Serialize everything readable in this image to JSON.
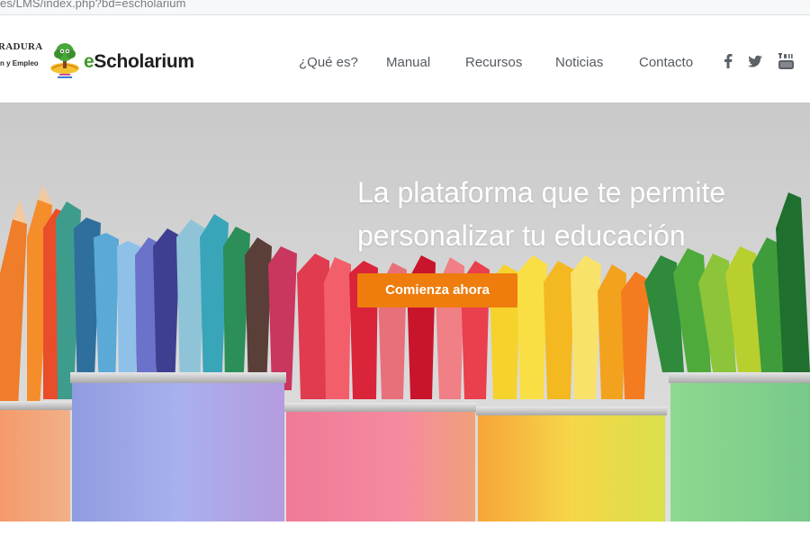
{
  "browser": {
    "url_text": "es/LMS/index.php?bd=escholarium"
  },
  "header": {
    "gov_logo_line1": "RADURA",
    "gov_logo_line2": "n y Empleo",
    "brand_name_prefix": "e",
    "brand_name_rest": "Scholarium",
    "brand_icon": "tree-book-icon"
  },
  "nav": {
    "items": [
      {
        "label": "¿Qué es?"
      },
      {
        "label": "Manual"
      },
      {
        "label": "Recursos"
      },
      {
        "label": "Noticias"
      },
      {
        "label": "Contacto"
      }
    ],
    "social": [
      {
        "icon": "facebook-icon"
      },
      {
        "icon": "twitter-icon"
      },
      {
        "icon": "youtube-icon"
      }
    ]
  },
  "hero": {
    "title": "La plataforma que te permite personalizar tu educación",
    "cta_label": "Comienza ahora",
    "image": "colored-pencils-in-cans"
  },
  "colors": {
    "cta_orange": "#ee7d0d",
    "brand_green": "#3f9a2a",
    "nav_text": "#555a60"
  }
}
